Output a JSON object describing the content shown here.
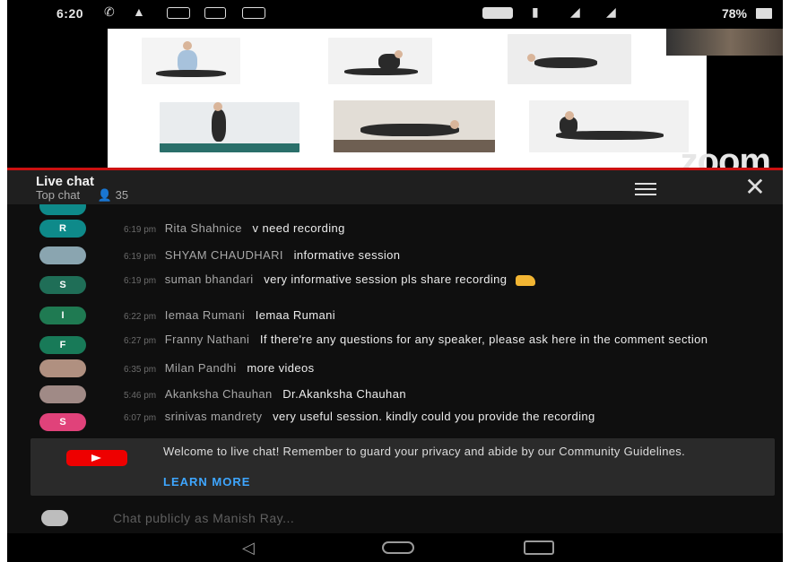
{
  "status_bar": {
    "time": "6:20",
    "battery": "78%",
    "icons": [
      "whatsapp-icon",
      "notification-icon",
      "me-icon",
      "message-icon",
      "email-icon",
      "volte-icon",
      "vibrate-icon",
      "4g-signal-icon",
      "signal-icon",
      "battery-icon"
    ]
  },
  "video": {
    "watermark": "zoom"
  },
  "chat": {
    "title": "Live chat",
    "mode": "Top chat",
    "viewers": "35",
    "messages": [
      {
        "avatar": "R",
        "avatar_color": "#0e8a8a",
        "time": "6:19 pm",
        "author": "Rita Shahnice",
        "text": "v need recording"
      },
      {
        "avatar": "",
        "avatar_color": "#8aa5b0",
        "time": "6:19 pm",
        "author": "SHYAM CHAUDHARI",
        "text": "informative session"
      },
      {
        "avatar": "S",
        "avatar_color": "#1f6e57",
        "time": "6:19 pm",
        "author": "suman bhandari",
        "text": "very informative session pls share recording"
      },
      {
        "avatar": "I",
        "avatar_color": "#1f7a52",
        "time": "6:22 pm",
        "author": "Iemaa Rumani",
        "text": "Iemaa Rumani"
      },
      {
        "avatar": "F",
        "avatar_color": "#187a58",
        "time": "6:27 pm",
        "author": "Franny Nathani",
        "text": "If there're any questions for any speaker, please ask here in the comment section"
      },
      {
        "avatar": "",
        "avatar_color": "#b09080",
        "time": "6:35 pm",
        "author": "Milan Pandhi",
        "text": "more videos"
      },
      {
        "avatar": "",
        "avatar_color": "#a08a86",
        "time": "5:46 pm",
        "author": "Akanksha Chauhan",
        "text": "Dr.Akanksha Chauhan"
      },
      {
        "avatar": "S",
        "avatar_color": "#e0427a",
        "time": "6:07 pm",
        "author": "srinivas mandrety",
        "text": "very useful session. kindly could you provide the recording"
      }
    ]
  },
  "notice": {
    "text": "Welcome to live chat! Remember to guard your privacy and abide by our Community Guidelines.",
    "link": "LEARN MORE"
  },
  "input": {
    "placeholder": "Chat publicly as Manish Ray..."
  },
  "colors": {
    "accent_link": "#3ea6ff",
    "youtube_red": "#e00000",
    "divider_red": "#cc1111"
  }
}
